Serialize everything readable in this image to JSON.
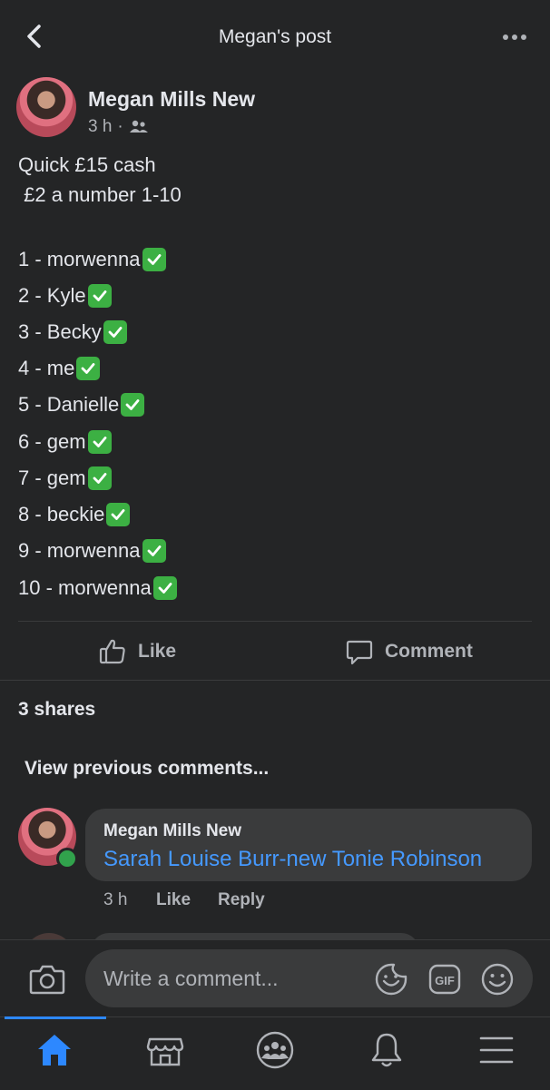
{
  "header": {
    "title": "Megan's post"
  },
  "post": {
    "author": "Megan Mills New",
    "time": "3 h",
    "separator": "·",
    "body": [
      "Quick £15 cash",
      " £2 a number 1-10",
      "1 - morwenna",
      "2 - Kyle",
      "3 - Becky",
      "4 - me",
      "5 - Danielle",
      "6 - gem",
      "7 - gem",
      "8 - beckie",
      "9 - morwenna",
      "10 - morwenna"
    ],
    "actions": {
      "like": "Like",
      "comment": "Comment"
    },
    "shares": "3 shares",
    "view_previous": "View previous comments..."
  },
  "comment": {
    "author": "Megan Mills New",
    "text": "Sarah Louise Burr-new Tonie Robinson",
    "time": "3 h",
    "like": "Like",
    "reply": "Reply"
  },
  "composer": {
    "placeholder": "Write a comment..."
  },
  "tabs": [
    "home-icon",
    "marketplace-icon",
    "groups-icon",
    "notifications-icon",
    "menu-icon"
  ],
  "colors": {
    "background": "#242526",
    "accent": "#2d88ff",
    "link": "#4599ff",
    "check": "#3cb043",
    "online": "#31a24c"
  }
}
